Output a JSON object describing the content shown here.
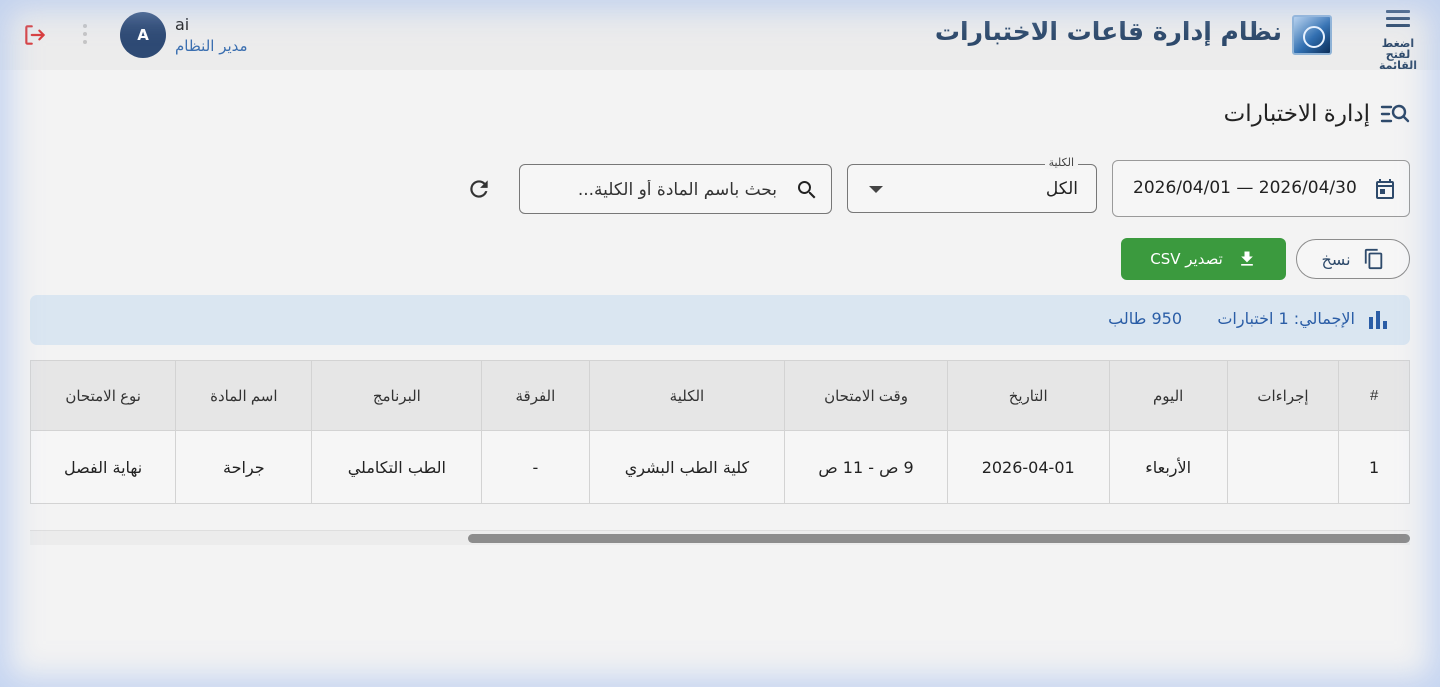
{
  "header": {
    "menu_caption": "اضغط لفتح القائمة",
    "app_title": "نظام إدارة قاعات الاختبارات",
    "user": {
      "name": "ai",
      "role": "مدير النظام",
      "initial": "A"
    }
  },
  "page": {
    "title": "إدارة الاختبارات"
  },
  "filters": {
    "date_range": "2026/04/01 — 2026/04/30",
    "college_label": "الكلية",
    "college_value": "الكل",
    "search_placeholder": "بحث باسم المادة أو الكلية..."
  },
  "actions": {
    "copy_label": "نسخ",
    "export_label": "تصدير CSV"
  },
  "summary": {
    "total_text": "الإجمالي: 1 اختبارات",
    "students_text": "950 طالب"
  },
  "table": {
    "columns": [
      "#",
      "إجراءات",
      "اليوم",
      "التاريخ",
      "وقت الامتحان",
      "الكلية",
      "الفرقة",
      "البرنامج",
      "اسم المادة",
      "نوع الامتحان"
    ],
    "rows": [
      {
        "index": "1",
        "actions": "",
        "day": "الأربعاء",
        "date": "2026-04-01",
        "time": "9 ص - 11 ص",
        "college": "كلية الطب البشري",
        "level": "-",
        "program": "الطب التكاملي",
        "subject": "جراحة",
        "type": "نهاية الفصل"
      }
    ]
  },
  "colors": {
    "primary": "#2e4a6b",
    "accent": "#3b6fb0",
    "success": "#3b9a3e",
    "danger": "#d93b3b",
    "summary_bg": "#dae6f1"
  },
  "icons": [
    "menu-icon",
    "calendar-icon",
    "search-icon",
    "refresh-icon",
    "copy-icon",
    "download-icon",
    "bar-chart-icon",
    "logout-icon",
    "more-vert-icon",
    "manage-search-icon"
  ]
}
